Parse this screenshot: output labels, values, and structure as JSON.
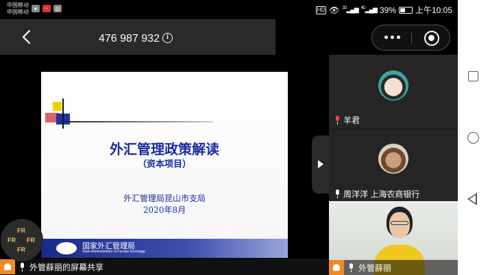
{
  "status_bar": {
    "carrier_1": "中国移动",
    "carrier_2": "中国移动",
    "network_1": "2G",
    "network_2": "4G",
    "battery": "39%",
    "time": "上午10:05",
    "hd_label": "HD"
  },
  "header": {
    "meeting_id": "476 987 932"
  },
  "slide": {
    "title": "外汇管理政策解读",
    "subtitle": "（资本项目）",
    "organization": "外汇管理局昆山市支局",
    "date": "2020年8月",
    "footer_cn": "国家外汇管理局",
    "footer_en": "State Administration of Foreign Exchange",
    "logo_text": "SAFE"
  },
  "participants": [
    {
      "name": "羊君",
      "mic": "muted"
    },
    {
      "name": "周洋洋 上海农商银行",
      "mic": "on"
    },
    {
      "name": "外管薛丽",
      "mic": "on"
    }
  ],
  "share_status": "外管薛丽的屏幕共享",
  "app_logo_text": "FR"
}
